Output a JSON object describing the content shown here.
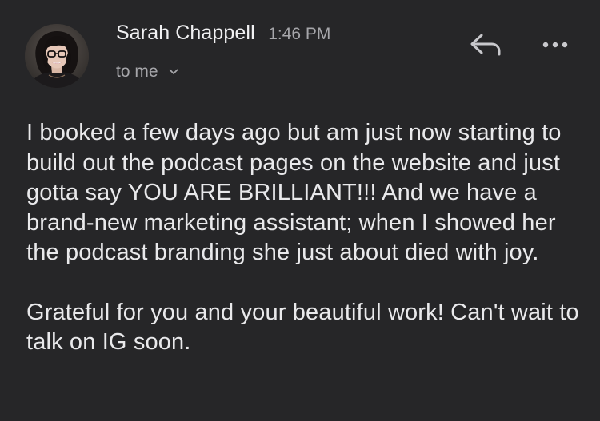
{
  "email": {
    "sender": {
      "name": "Sarah Chappell",
      "time": "1:46 PM",
      "avatar_icon": "person-avatar"
    },
    "recipient_label": "to me",
    "actions": {
      "reply_icon": "reply-icon",
      "more_icon": "more-options-icon"
    },
    "body": {
      "paragraph_1": "I booked a few days ago but am just now starting to build out the podcast pages on the website and just gotta say YOU ARE BRILLIANT!!! And we have a brand-new marketing assistant; when I showed her the podcast branding she just about died with joy.",
      "paragraph_2": "Grateful for you and your beautiful work! Can't wait to talk on IG soon."
    }
  },
  "colors": {
    "background": "#262628",
    "primary_text": "#e9e9eb",
    "secondary_text": "#a6a6aa"
  }
}
